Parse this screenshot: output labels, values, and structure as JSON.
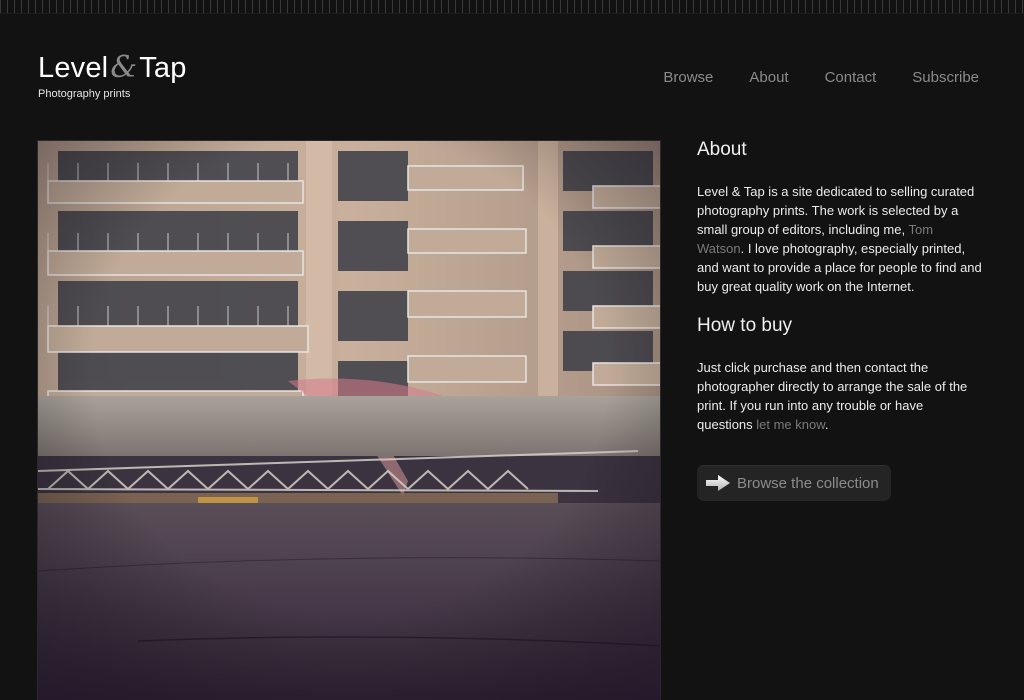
{
  "brand": {
    "name_left": "Level",
    "name_amp": "&",
    "name_right": "Tap",
    "tagline": "Photography prints"
  },
  "nav": {
    "items": [
      {
        "label": "Browse"
      },
      {
        "label": "About"
      },
      {
        "label": "Contact"
      },
      {
        "label": "Subscribe"
      }
    ]
  },
  "sidebar": {
    "about": {
      "heading": "About",
      "text_before": "Level & Tap is a site dedicated to selling curated photography prints. The work is selected by a small group of editors, including me, ",
      "link": "Tom Watson",
      "text_after": ". I love photography, especially printed, and want to provide a place for people to find and buy great quality work on the Internet."
    },
    "how_to_buy": {
      "heading": "How to buy",
      "text_before": "Just click purchase and then contact the photographer directly to arrange the sale of the print. If you run into any trouble or have questions ",
      "link": "let me know",
      "text_after": "."
    },
    "cta": {
      "label": "Browse the collection",
      "icon": "arrow-right-icon"
    }
  },
  "photo": {
    "subject": "apartment-building-photo"
  },
  "colors": {
    "background": "#121212",
    "nav_text": "#8b8b8b",
    "link": "#7a7a7a",
    "button_bg": "#242424"
  }
}
